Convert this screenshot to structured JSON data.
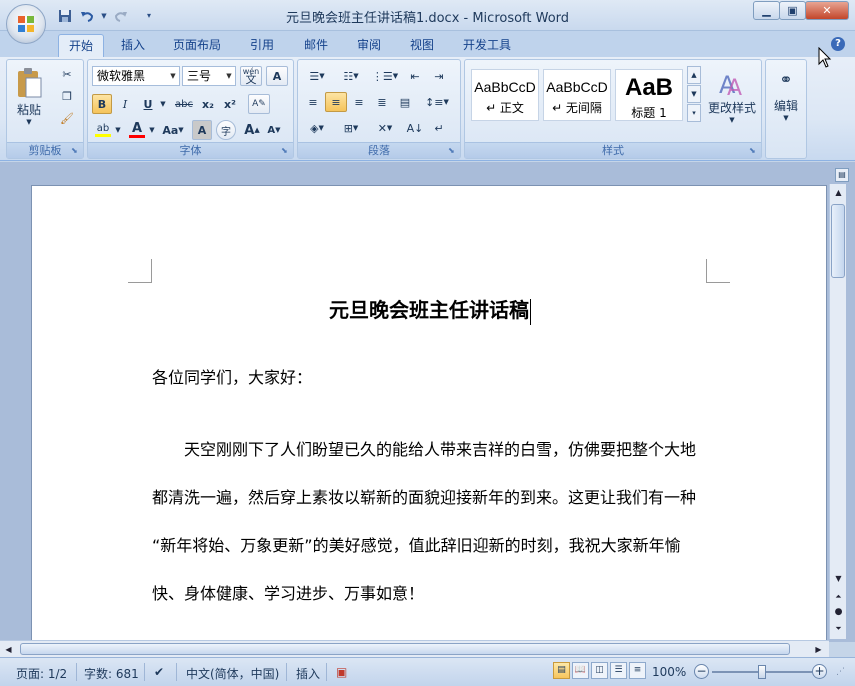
{
  "window": {
    "title": "元旦晚会班主任讲话稿1.docx - Microsoft Word",
    "minimize_icon": "minimize-icon",
    "maximize_icon": "restore-icon",
    "close_icon": "close-icon"
  },
  "quick_access": {
    "save": "save-icon",
    "undo": "undo-icon",
    "redo": "redo-icon",
    "customize": "customize-qat-icon"
  },
  "tabs": [
    "开始",
    "插入",
    "页面布局",
    "引用",
    "邮件",
    "审阅",
    "视图",
    "开发工具"
  ],
  "active_tab": "开始",
  "ribbon": {
    "clipboard": {
      "label": "剪贴板",
      "paste": "粘贴"
    },
    "font": {
      "label": "字体",
      "family": "微软雅黑",
      "size": "三号",
      "bold": "B",
      "italic": "I",
      "underline": "U",
      "strike": "abc",
      "subscript": "x₂",
      "superscript": "x²",
      "change_case": "Aa",
      "grow": "A",
      "shrink": "A",
      "char_border": "A",
      "enclose": "字",
      "phonetic": "wén",
      "highlight_color": "#ffff00",
      "font_color": "#ff0000"
    },
    "paragraph": {
      "label": "段落"
    },
    "styles": {
      "label": "样式",
      "items": [
        {
          "sample": "AaBbCcD",
          "name": "↵ 正文"
        },
        {
          "sample": "AaBbCcD",
          "name": "↵ 无间隔"
        },
        {
          "sample": "AaB",
          "name": "标题 1"
        }
      ],
      "change_styles": "更改样式"
    },
    "editing": {
      "label": "编辑"
    }
  },
  "document": {
    "title": "元旦晚会班主任讲话稿",
    "greeting": "各位同学们，大家好：",
    "paragraph_lines": [
      "　　天空刚刚下了人们盼望已久的能给人带来吉祥的白雪，仿佛要把整个大地",
      "都清洗一遍，然后穿上素妆以崭新的面貌迎接新年的到来。这更让我们有一种",
      "“新年将始、万象更新”的美好感觉，值此辞旧迎新的时刻，我祝大家新年愉",
      "快、身体健康、学习进步、万事如意！"
    ]
  },
  "status": {
    "page": "页面: 1/2",
    "words": "字数: 681",
    "language": "中文(简体，中国)",
    "insert_mode": "插入",
    "zoom": "100%",
    "zoom_percent": 100
  }
}
